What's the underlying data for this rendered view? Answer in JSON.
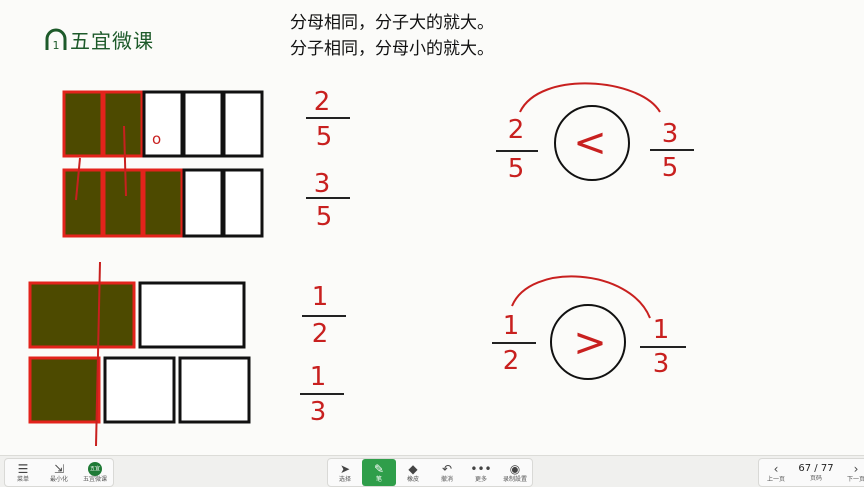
{
  "brand": {
    "name": "五宜微课",
    "mark": "1"
  },
  "rules": {
    "line1": "分母相同，分子大的就大。",
    "line2": "分子相同，分母小的就大。"
  },
  "colors": {
    "shade": "#4d4a00",
    "shade_border": "#e3231c",
    "ink": "#c8201f"
  },
  "bar_models": {
    "row1": {
      "parts": 5,
      "shaded": 2
    },
    "row2": {
      "parts": 5,
      "shaded": 3
    },
    "row3": {
      "parts": 2,
      "shaded": 1
    },
    "row4": {
      "parts": 3,
      "shaded": 1
    }
  },
  "fractions": {
    "f1": {
      "num": "2",
      "den": "5"
    },
    "f2": {
      "num": "3",
      "den": "5"
    },
    "f3": {
      "num": "1",
      "den": "2"
    },
    "f4": {
      "num": "1",
      "den": "3"
    }
  },
  "comparisons": {
    "c1": {
      "left_num": "2",
      "left_den": "5",
      "symbol": "<",
      "right_num": "3",
      "right_den": "5"
    },
    "c2": {
      "left_num": "1",
      "left_den": "2",
      "symbol": ">",
      "right_num": "1",
      "right_den": "3"
    }
  },
  "annotation_mark": "o",
  "toolbar": {
    "menu": {
      "icon": "menu-icon",
      "label": "菜单"
    },
    "minimize": {
      "icon": "minimize-icon",
      "label": "最小化"
    },
    "app": {
      "icon": "app-logo-icon",
      "label": "五宜微课",
      "glyph": "五宜"
    },
    "select": {
      "icon": "cursor-icon",
      "label": "选择"
    },
    "pen": {
      "icon": "pen-icon",
      "label": "笔"
    },
    "eraser": {
      "icon": "eraser-icon",
      "label": "橡皮"
    },
    "undo": {
      "icon": "undo-icon",
      "label": "撤消"
    },
    "more": {
      "icon": "more-icon",
      "label": "更多"
    },
    "record": {
      "icon": "record-icon",
      "label": "录制設置"
    },
    "prev": {
      "icon": "chevron-left-icon",
      "label": "上一页"
    },
    "page": {
      "current": 67,
      "total": 77,
      "text": "67 / 77",
      "label": "页码"
    },
    "next": {
      "icon": "chevron-right-icon",
      "label": "下一页"
    }
  }
}
